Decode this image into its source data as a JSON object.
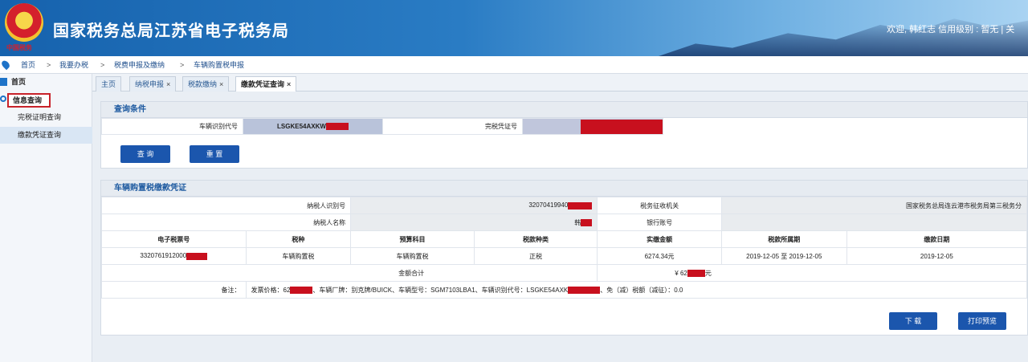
{
  "header": {
    "title": "国家税务总局江苏省电子税务局",
    "logo_text": "中国税务",
    "welcome": "欢迎, 韩红志  信用级别 : 暂无  |  关"
  },
  "breadcrumb": [
    "首页",
    ">",
    "我要办税",
    ">",
    "税费申报及缴纳",
    ">",
    "车辆购置税申报"
  ],
  "sidebar": {
    "home": "首页",
    "info_query": "信息查询",
    "items": [
      "完税证明查询",
      "缴款凭证查询"
    ]
  },
  "tabs": [
    {
      "label": "主页",
      "closable": false
    },
    {
      "label": "纳税申报",
      "closable": true
    },
    {
      "label": "税款缴纳",
      "closable": true
    },
    {
      "label": "缴款凭证查询",
      "closable": true
    }
  ],
  "query": {
    "title": "查询条件",
    "vin_label": "车辆识别代号",
    "vin_value": "LSGKE54AXKW",
    "cert_label": "完税凭证号",
    "search_btn": "查 询",
    "reset_btn": "重 置"
  },
  "voucher": {
    "title": "车辆购置税缴款凭证",
    "taxpayer_id_label": "纳税人识别号",
    "taxpayer_id_value": "32070419940",
    "authority_label": "税务征收机关",
    "authority_value": "国家税务总局连云港市税务局第三税务分",
    "name_label": "纳税人名称",
    "name_value": "韩",
    "bank_label": "银行账号",
    "columns": [
      "电子税票号",
      "税种",
      "预算科目",
      "税款种类",
      "实缴金额",
      "税款所属期",
      "缴款日期"
    ],
    "row": {
      "ticket": "3320761912000",
      "tax_type": "车辆购置税",
      "budget": "车辆购置税",
      "kind": "正税",
      "amount": "6274.34元",
      "period": "2019-12-05 至 2019-12-05",
      "date": "2019-12-05"
    },
    "total_label": "金额合计",
    "total_prefix": "¥ 62",
    "total_suffix": "元",
    "remark_label": "备注：",
    "remark_part1": "发票价格：62",
    "remark_part2": "车辆厂牌：别克牌/BUICK、车辆型号：SGM7103LBA1、车辆识别代号：LSGKE54AXK",
    "remark_part3": "、免（减）税额（减征）：0.0",
    "download_btn": "下 载",
    "print_btn": "打印预览"
  },
  "colors": {
    "accent": "#1b56ad",
    "redaction": "#c8101e",
    "highlight_box": "#c8222a"
  }
}
